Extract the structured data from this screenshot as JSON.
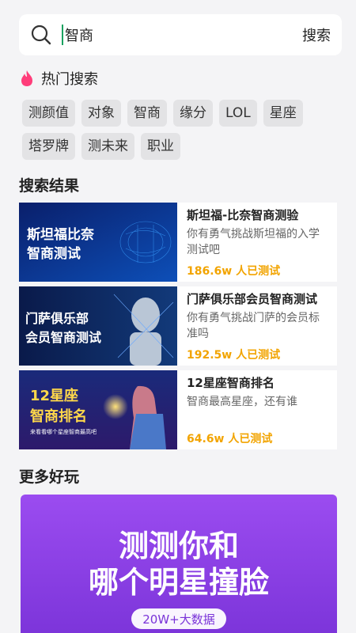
{
  "search": {
    "value": "智商",
    "button_label": "搜索"
  },
  "hot": {
    "title": "热门搜索",
    "tags": [
      "测颜值",
      "对象",
      "智商",
      "缘分",
      "LOL",
      "星座",
      "塔罗牌",
      "测未来",
      "职业"
    ]
  },
  "results_title": "搜索结果",
  "results": [
    {
      "thumb_text": [
        "斯坦福比奈",
        "智商测试"
      ],
      "title": "斯坦福-比奈智商测验",
      "desc": "你有勇气挑战斯坦福的入学测试吧",
      "count": "186.6w 人已测试"
    },
    {
      "thumb_text": [
        "门萨俱乐部",
        "会员智商测试"
      ],
      "title": "门萨俱乐部会员智商测试",
      "desc": "你有勇气挑战门萨的会员标准吗",
      "count": "192.5w 人已测试"
    },
    {
      "thumb_text": [
        "12星座",
        "智商排名",
        "来看看哪个星座智商最高吧"
      ],
      "title": "12星座智商排名",
      "desc": "智商最高星座，还有谁",
      "count": "64.6w 人已测试"
    }
  ],
  "more_title": "更多好玩",
  "banner": {
    "line1": "测测你和",
    "line2": "哪个明星撞脸",
    "badge": "20W+大数据"
  },
  "colors": {
    "accent_count": "#f2a400",
    "fire": "#ff3d7a",
    "banner_purple": "#8a3de0"
  }
}
